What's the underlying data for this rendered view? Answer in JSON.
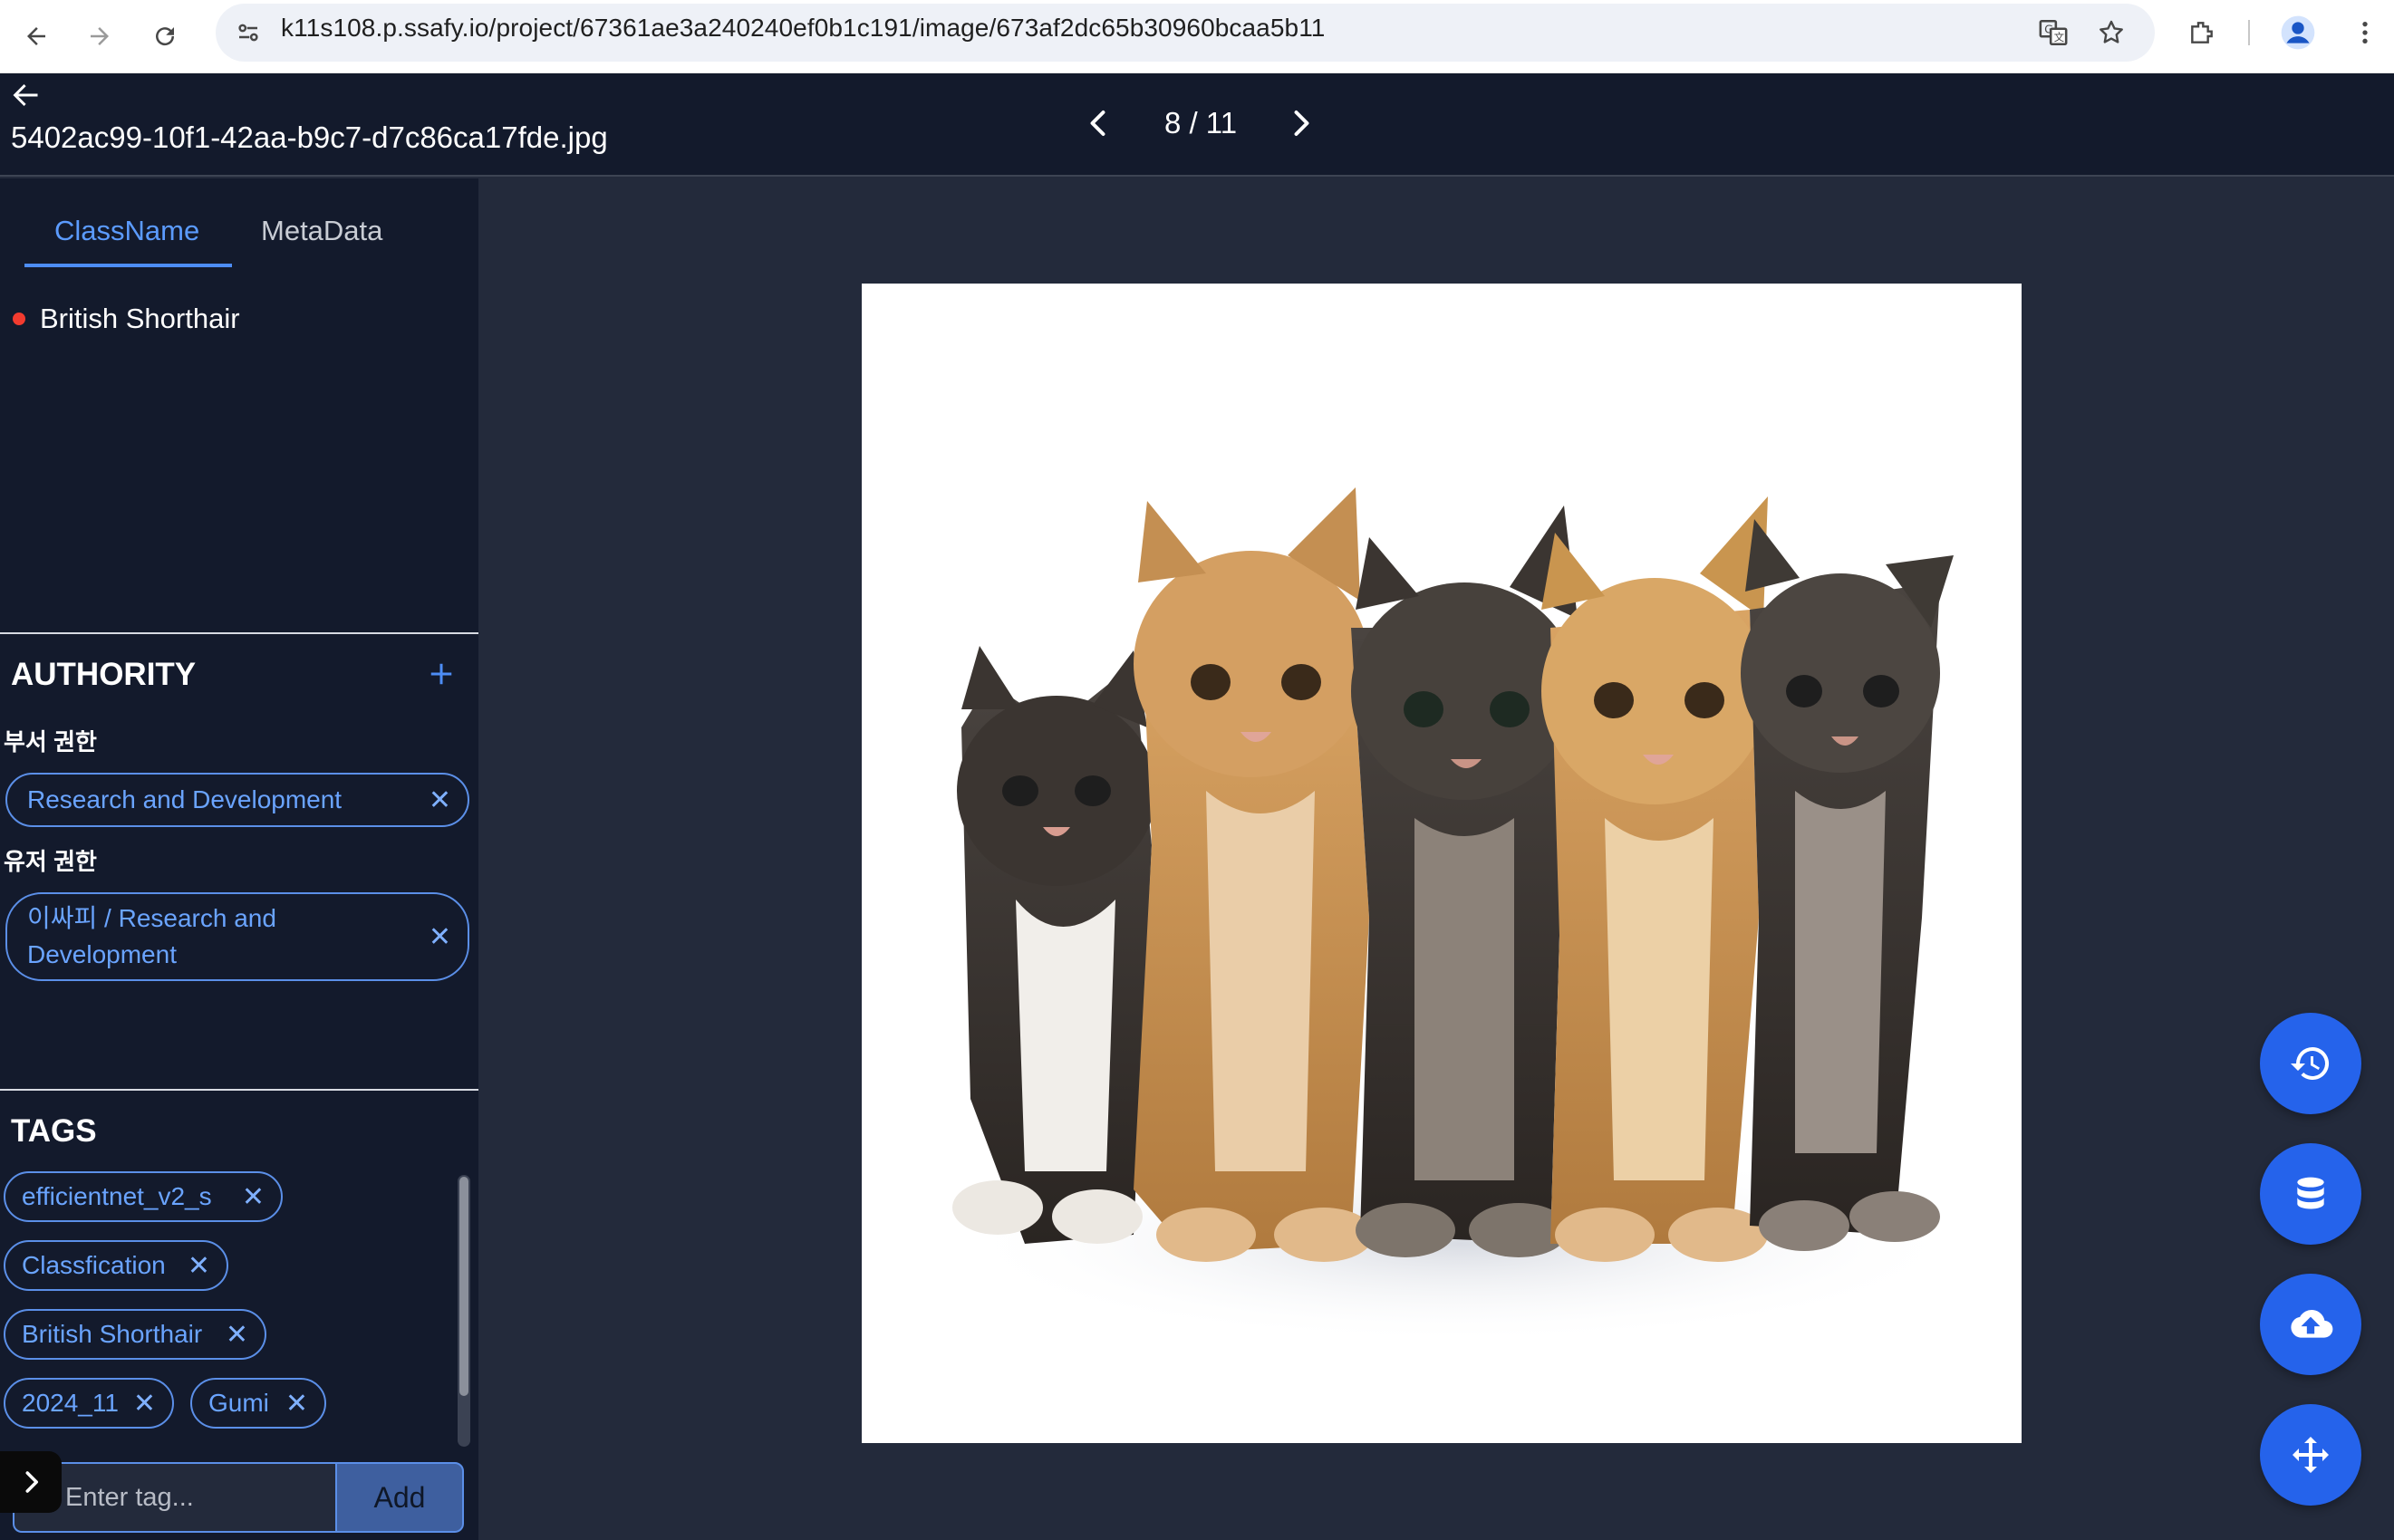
{
  "browser": {
    "url": "k11s108.p.ssafy.io/project/67361ae3a240240ef0b1c191/image/673af2dc65b30960bcaa5b11",
    "icons": [
      "back-icon",
      "forward-icon",
      "reload-icon",
      "site-info-icon",
      "translate-icon",
      "bookmark-star-icon",
      "extensions-icon",
      "profile-icon",
      "menu-kebab-icon"
    ]
  },
  "header": {
    "filename": "5402ac99-10f1-42aa-b9c7-d7c86ca17fde.jpg",
    "counter": "8 / 11"
  },
  "sidebar": {
    "tabs": [
      {
        "label": "ClassName",
        "active": true
      },
      {
        "label": "MetaData",
        "active": false
      }
    ],
    "class_item": {
      "label": "British Shorthair",
      "color": "#f23b2f"
    },
    "authority": {
      "title": "AUTHORITY",
      "department_label": "부서 권한",
      "department_chips": [
        "Research and Development"
      ],
      "user_label": "유저 권한",
      "user_chip_line1": "이싸피 / Research and",
      "user_chip_line2": "Development"
    },
    "tags": {
      "title": "TAGS",
      "items": [
        "efficientnet_v2_s",
        "Classfication",
        "British Shorthair",
        "2024_11",
        "Gumi"
      ],
      "input_placeholder": "Enter tag...",
      "add_label": "Add"
    }
  },
  "viewer": {
    "image_subject": "five kittens sitting in a row on white background",
    "fabs": [
      "history-icon",
      "database-icon",
      "cloud-upload-icon",
      "move-icon"
    ]
  },
  "colors": {
    "accent": "#2563eb",
    "header_bg": "#131a2c",
    "viewer_bg": "#232a3b",
    "chip_text": "#6aa4ff"
  }
}
